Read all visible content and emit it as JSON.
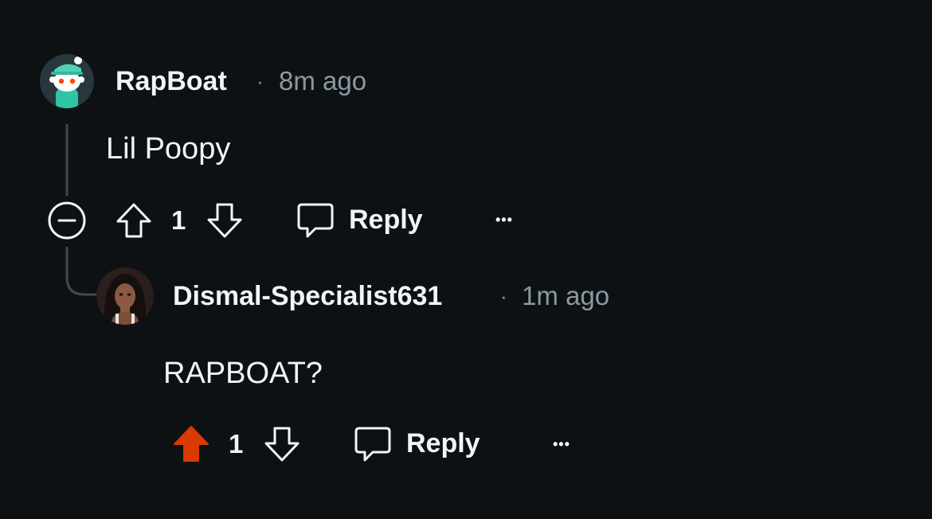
{
  "thread": {
    "parent": {
      "author": "RapBoat",
      "separator": "·",
      "time": "8m ago",
      "body": "Lil Poopy",
      "votes": "1",
      "reply_label": "Reply",
      "more_label": "•••",
      "upvoted": false
    },
    "child": {
      "author": "Dismal-Specialist631",
      "separator": "·",
      "time": "1m ago",
      "body": "RAPBOAT?",
      "votes": "1",
      "reply_label": "Reply",
      "more_label": "•••",
      "upvoted": true
    }
  },
  "colors": {
    "background": "#0e1113",
    "upvote_active": "#d93a00",
    "meta_text": "#8a9aa3",
    "thread_line": "#3e4a52"
  },
  "icons": {
    "collapse": "collapse-minus-icon",
    "upvote": "upvote-arrow-icon",
    "downvote": "downvote-arrow-icon",
    "reply": "comment-bubble-icon",
    "more": "more-options-icon"
  }
}
